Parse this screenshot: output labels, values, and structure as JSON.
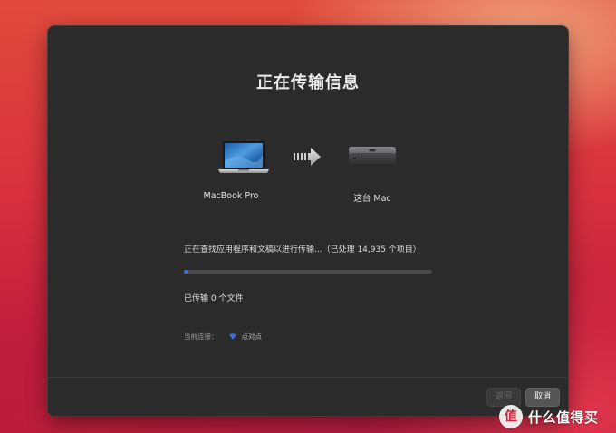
{
  "dialog": {
    "title": "正在传输信息",
    "source_device": {
      "label": "MacBook Pro",
      "icon": "laptop-icon"
    },
    "target_device": {
      "label": "这台 Mac",
      "icon": "mac-mini-icon"
    },
    "transfer_arrow_icon": "transfer-arrow-icon",
    "status_text": "正在查找应用程序和文稿以进行传输...（已处理 14,935 个项目）",
    "progress_percent": 2,
    "files_transferred_text": "已传输 0 个文件",
    "connection": {
      "label": "当前连接：",
      "icon": "wifi-icon",
      "name": "点对点"
    },
    "buttons": {
      "back": "返回",
      "cancel": "取消"
    }
  },
  "watermark": {
    "badge": "值",
    "text": "什么值得买"
  },
  "colors": {
    "dialog_bg": "#2b2b2b",
    "progress_fill": "#3a6fd8",
    "progress_track": "#4a4a4a",
    "wifi": "#3a6fd8"
  }
}
